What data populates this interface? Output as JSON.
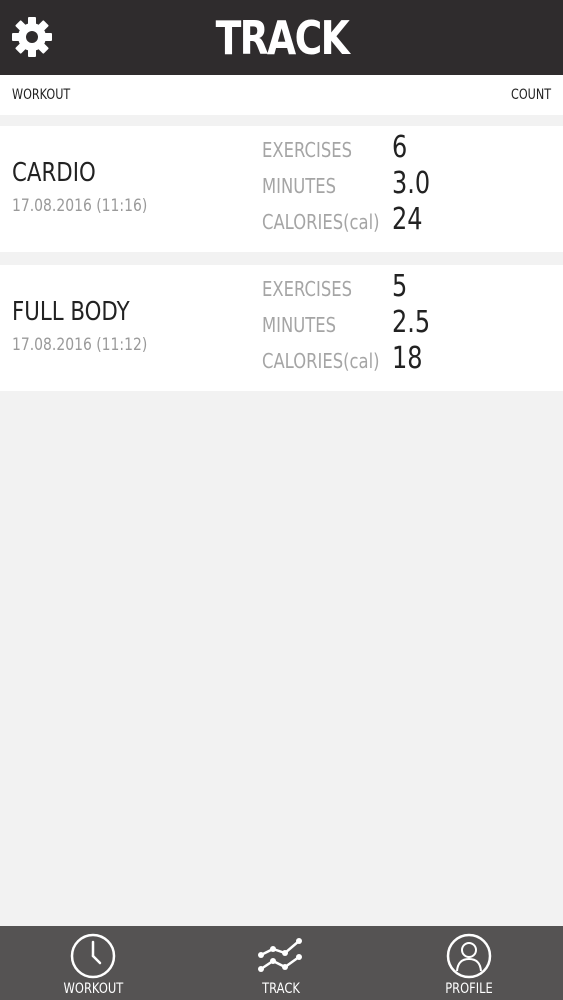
{
  "header": {
    "title": "TRACK",
    "settings_icon": "gear-icon"
  },
  "columns": {
    "left": "WORKOUT",
    "right": "COUNT"
  },
  "workouts": [
    {
      "name": "CARDIO",
      "date": "17.08.2016 (11:16)",
      "exercises_label": "EXERCISES",
      "exercises": "6",
      "minutes_label": "MINUTES",
      "minutes": "3.0",
      "calories_label": "CALORIES(cal)",
      "calories": "24"
    },
    {
      "name": "FULL BODY",
      "date": "17.08.2016 (11:12)",
      "exercises_label": "EXERCISES",
      "exercises": "5",
      "minutes_label": "MINUTES",
      "minutes": "2.5",
      "calories_label": "CALORIES(cal)",
      "calories": "18"
    }
  ],
  "tabbar": {
    "tabs": [
      {
        "label": "WORKOUT",
        "icon": "clock-icon"
      },
      {
        "label": "TRACK",
        "icon": "chart-line-icon"
      },
      {
        "label": "PROFILE",
        "icon": "user-icon"
      }
    ]
  },
  "colors": {
    "header_bg": "#2f2c2d",
    "tabbar_bg": "#555353",
    "page_bg": "#f2f2f2",
    "card_bg": "#ffffff"
  }
}
